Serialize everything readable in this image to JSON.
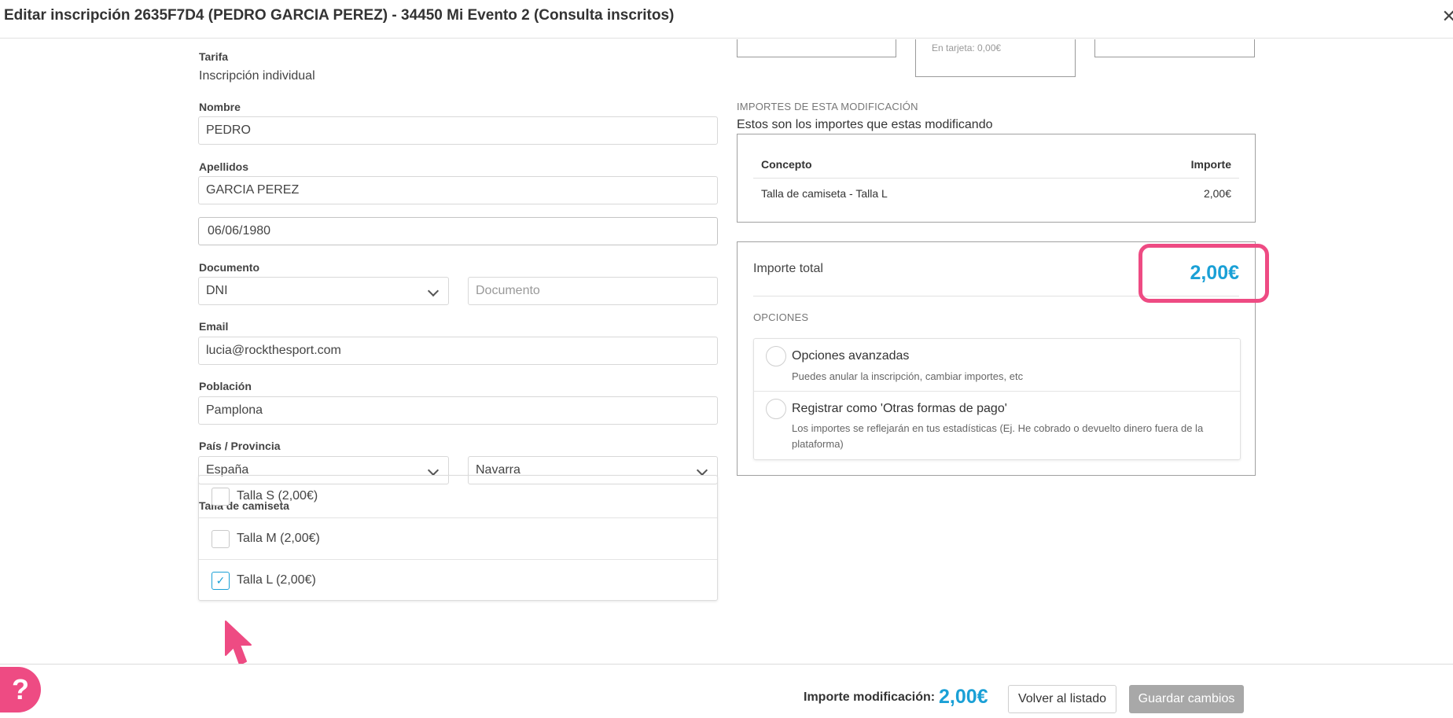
{
  "header": {
    "title": "Editar inscripción 2635F7D4 (PEDRO GARCIA PEREZ) - 34450 Mi Evento 2 (Consulta inscritos)",
    "close_icon": "close-icon"
  },
  "form": {
    "tarifa_label": "Tarifa",
    "tarifa_value": "Inscripción individual",
    "nombre_label": "Nombre",
    "nombre_value": "PEDRO",
    "apellidos_label": "Apellidos",
    "apellidos_value": "GARCIA PEREZ",
    "fecha_value": "06/06/1980",
    "documento_label": "Documento",
    "documento_tipo": "DNI",
    "documento_placeholder": "Documento",
    "email_label": "Email",
    "email_value": "lucia@rockthesport.com",
    "poblacion_label": "Población",
    "poblacion_value": "Pamplona",
    "pais_label": "País / Provincia",
    "pais_value": "España",
    "provincia_value": "Navarra",
    "talla_label": "Talla de camiseta",
    "tallas": [
      {
        "label": "Talla S (2,00€)",
        "checked": false
      },
      {
        "label": "Talla M (2,00€)",
        "checked": false
      },
      {
        "label": "Talla L (2,00€)",
        "checked": true
      }
    ]
  },
  "summary": {
    "partial_text": "En tarjeta: 0,00€",
    "section_title": "IMPORTES DE ESTA MODIFICACIÓN",
    "section_subtitle": "Estos son los importes que estas modificando",
    "table": {
      "headers": [
        "Concepto",
        "Importe"
      ],
      "rows": [
        {
          "concepto": "Talla de camiseta - Talla L",
          "importe": "2,00€"
        }
      ]
    },
    "total_label": "Importe total",
    "total_value": "2,00€",
    "options_title": "OPCIONES",
    "options": [
      {
        "title": "Opciones avanzadas",
        "desc": "Puedes anular la inscripción, cambiar importes, etc"
      },
      {
        "title": "Registrar como 'Otras formas de pago'",
        "desc": "Los importes se reflejarán en tus estadísticas (Ej. He cobrado o devuelto dinero fuera de la plataforma)"
      }
    ]
  },
  "footer": {
    "help_label": "?",
    "modificacion_label": "Importe modificación:",
    "modificacion_value": "2,00€",
    "back_label": "Volver al listado",
    "save_label": "Guardar cambios"
  },
  "colors": {
    "accent": "#1aa0d6",
    "highlight": "#ee4b83",
    "disabled_button": "#a8a8a8"
  }
}
